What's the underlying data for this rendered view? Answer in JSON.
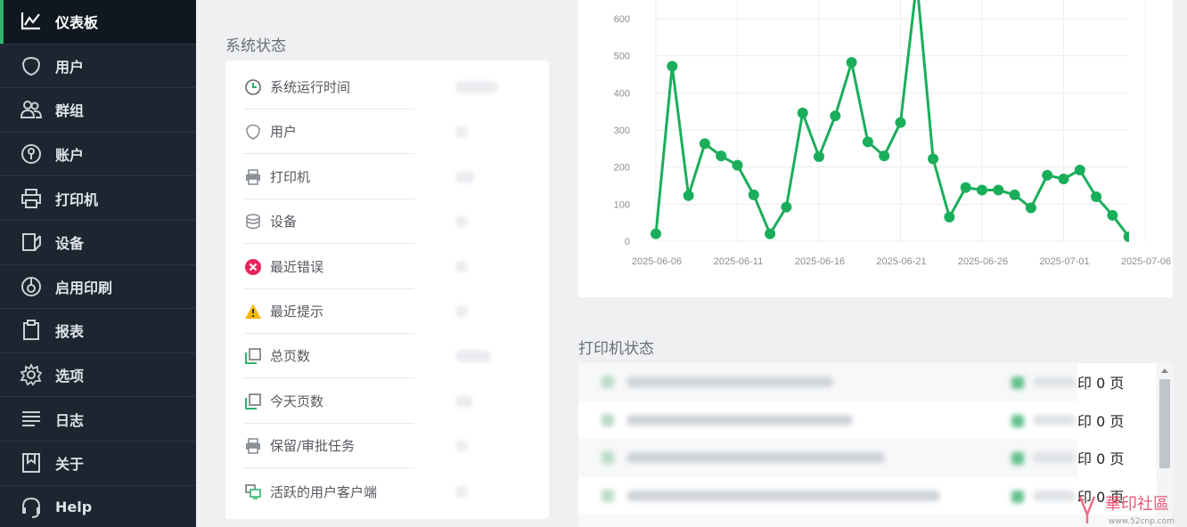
{
  "sidebar": {
    "items": [
      {
        "label": "仪表板",
        "icon": "chart-line-icon",
        "active": true
      },
      {
        "label": "用户",
        "icon": "user-shield-icon"
      },
      {
        "label": "群组",
        "icon": "group-icon"
      },
      {
        "label": "账户",
        "icon": "account-icon"
      },
      {
        "label": "打印机",
        "icon": "printer-icon"
      },
      {
        "label": "设备",
        "icon": "device-icon"
      },
      {
        "label": "启用印刷",
        "icon": "release-icon"
      },
      {
        "label": "报表",
        "icon": "clipboard-icon"
      },
      {
        "label": "选项",
        "icon": "gear-icon"
      },
      {
        "label": "日志",
        "icon": "log-lines-icon"
      },
      {
        "label": "关于",
        "icon": "bookmark-icon"
      },
      {
        "label": "Help",
        "icon": "headset-icon"
      }
    ]
  },
  "system_status": {
    "title": "系统状态",
    "rows": [
      {
        "label": "系统运行时间",
        "icon": "clock-icon",
        "color": "#2fb36a"
      },
      {
        "label": "用户",
        "icon": "user-shield-icon",
        "color": "#8b9197"
      },
      {
        "label": "打印机",
        "icon": "printer-icon",
        "color": "#8b9197"
      },
      {
        "label": "设备",
        "icon": "database-icon",
        "color": "#8b9197"
      },
      {
        "label": "最近错误",
        "icon": "error-x-icon",
        "color": "#e8245c"
      },
      {
        "label": "最近提示",
        "icon": "warning-icon",
        "color": "#f2b705"
      },
      {
        "label": "总页数",
        "icon": "pages-icon",
        "color": "#2fb36a"
      },
      {
        "label": "今天页数",
        "icon": "pages-icon",
        "color": "#2fb36a"
      },
      {
        "label": "保留/审批任务",
        "icon": "printer-icon",
        "color": "#8b9197"
      },
      {
        "label": "活跃的用户客户端",
        "icon": "monitor-icon",
        "color": "#2fb36a"
      }
    ]
  },
  "printer_status": {
    "title": "打印机状态",
    "rows": [
      {
        "pages": "印 0 页"
      },
      {
        "pages": "印 0 页"
      },
      {
        "pages": "印 0 页"
      },
      {
        "pages": "印 0 页"
      }
    ]
  },
  "chart_data": {
    "type": "line",
    "color": "#1aae5b",
    "x_ticks": [
      "2025-06-06",
      "2025-06-11",
      "2025-06-16",
      "2025-06-21",
      "2025-06-26",
      "2025-07-01",
      "2025-07-06"
    ],
    "y_ticks": [
      "0",
      "100",
      "200",
      "300",
      "400",
      "500",
      "600"
    ],
    "ylim": [
      0,
      600
    ],
    "x_start": "2025-06-06",
    "series": [
      {
        "values": [
          20,
          472,
          123,
          263,
          230,
          205,
          125,
          20,
          92,
          346,
          228,
          338,
          482,
          268,
          230,
          320,
          700,
          222,
          65,
          145,
          138,
          138,
          125,
          90,
          178,
          168,
          192,
          120,
          70,
          12
        ]
      }
    ]
  },
  "watermark": {
    "text": "華印社區",
    "url": "www.52cnp.com"
  }
}
